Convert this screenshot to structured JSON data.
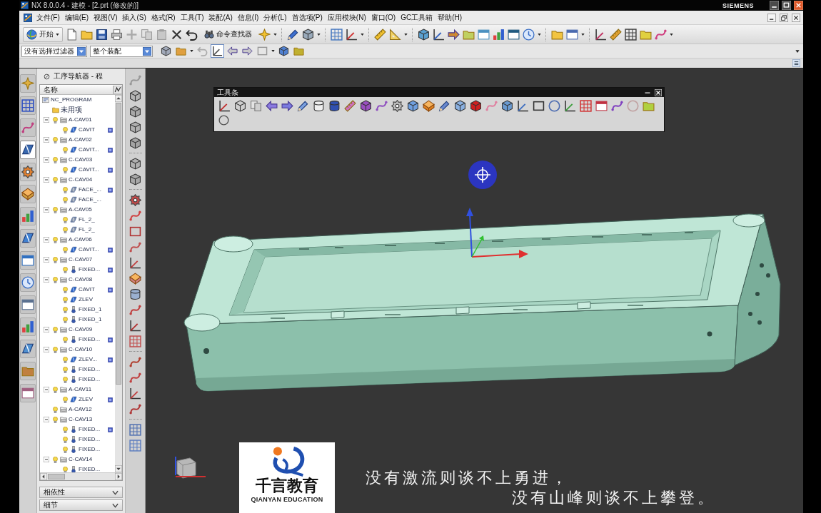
{
  "window": {
    "title": "NX 8.0.0.4 - 建模 - [2.prt (修改的)]",
    "brand": "SIEMENS"
  },
  "menu_bar": {
    "items": [
      "文件(F)",
      "编辑(E)",
      "视图(V)",
      "插入(S)",
      "格式(R)",
      "工具(T)",
      "装配(A)",
      "信息(I)",
      "分析(L)",
      "首选项(P)",
      "应用模块(N)",
      "窗口(O)",
      "GC工具箱",
      "帮助(H)"
    ]
  },
  "standard_toolbar": {
    "start_button": "开始",
    "command_finder": "命令查找器"
  },
  "selection_bar": {
    "type_filter": "没有选择过滤器",
    "scope": "整个装配",
    "tools": [
      {
        "selected": false
      },
      {
        "selected": false
      },
      {
        "selected": false
      },
      {
        "selected": true
      },
      {
        "selected": false
      },
      {
        "selected": false
      },
      {
        "selected": false
      },
      {
        "selected": false
      },
      {
        "selected": false
      }
    ]
  },
  "resource_bar": {
    "tabs": [
      {
        "selected": false
      },
      {
        "selected": false
      },
      {
        "selected": false
      },
      {
        "selected": true
      },
      {
        "selected": false
      },
      {
        "selected": false
      },
      {
        "selected": false
      },
      {
        "selected": false
      },
      {
        "selected": false
      },
      {
        "selected": false
      },
      {
        "selected": false
      },
      {
        "selected": false
      },
      {
        "selected": false
      },
      {
        "selected": false
      },
      {
        "selected": false
      }
    ]
  },
  "navigator": {
    "title": "工序导航器 - 程",
    "column": "名称",
    "tree": [
      {
        "label": "NC_PROGRAM",
        "kind": "root",
        "children": [
          {
            "label": "未用项",
            "kind": "folder"
          },
          {
            "label": "A-CAV01",
            "kind": "program",
            "expanded": true,
            "children": [
              {
                "label": "CAVIT",
                "kind": "rough",
                "flagged": true
              }
            ]
          },
          {
            "label": "A-CAV02",
            "kind": "program",
            "expanded": true,
            "children": [
              {
                "label": "CAVIT...",
                "kind": "rough",
                "flagged": true
              }
            ]
          },
          {
            "label": "C-CAV03",
            "kind": "program",
            "expanded": true,
            "children": [
              {
                "label": "CAVIT...",
                "kind": "rough",
                "flagged": true
              }
            ]
          },
          {
            "label": "C-CAV04",
            "kind": "program",
            "expanded": true,
            "children": [
              {
                "label": "FACE_...",
                "kind": "face",
                "flagged": true
              },
              {
                "label": "FACE_...",
                "kind": "face",
                "flagged": false
              }
            ]
          },
          {
            "label": "A-CAV05",
            "kind": "program",
            "expanded": true,
            "children": [
              {
                "label": "FL_2_",
                "kind": "face",
                "flagged": false
              },
              {
                "label": "FL_2_",
                "kind": "face",
                "flagged": false
              }
            ]
          },
          {
            "label": "A-CAV06",
            "kind": "program",
            "expanded": true,
            "children": [
              {
                "label": "CAVIT...",
                "kind": "rough",
                "flagged": true
              }
            ]
          },
          {
            "label": "C-CAV07",
            "kind": "program",
            "expanded": true,
            "children": [
              {
                "label": "FIXED...",
                "kind": "contour",
                "flagged": true
              }
            ]
          },
          {
            "label": "C-CAV08",
            "kind": "program",
            "expanded": true,
            "children": [
              {
                "label": "CAVIT",
                "kind": "rough",
                "flagged": true
              },
              {
                "label": "ZLEV",
                "kind": "rough",
                "flagged": false
              },
              {
                "label": "FIXED_1",
                "kind": "contour",
                "flagged": false
              },
              {
                "label": "FIXED_1",
                "kind": "contour",
                "flagged": false
              }
            ]
          },
          {
            "label": "C-CAV09",
            "kind": "program",
            "expanded": true,
            "children": [
              {
                "label": "FIXED...",
                "kind": "contour",
                "flagged": true
              }
            ]
          },
          {
            "label": "C-CAV10",
            "kind": "program",
            "expanded": true,
            "children": [
              {
                "label": "ZLEV...",
                "kind": "rough",
                "flagged": true
              },
              {
                "label": "FIXED...",
                "kind": "contour",
                "flagged": false
              },
              {
                "label": "FIXED...",
                "kind": "contour",
                "flagged": false
              }
            ]
          },
          {
            "label": "A-CAV11",
            "kind": "program",
            "expanded": true,
            "children": [
              {
                "label": "ZLEV",
                "kind": "rough",
                "flagged": true
              }
            ]
          },
          {
            "label": "A-CAV12",
            "kind": "program"
          },
          {
            "label": "C-CAV13",
            "kind": "program",
            "expanded": true,
            "children": [
              {
                "label": "FIXED...",
                "kind": "contour",
                "flagged": true
              },
              {
                "label": "FIXED...",
                "kind": "contour",
                "flagged": false
              },
              {
                "label": "FIXED...",
                "kind": "contour",
                "flagged": false
              }
            ]
          },
          {
            "label": "C-CAV14",
            "kind": "program",
            "expanded": true,
            "children": [
              {
                "label": "FIXED...",
                "kind": "contour",
                "flagged": false
              }
            ]
          }
        ]
      }
    ],
    "panels": [
      {
        "label": "相依性",
        "expanded": false
      },
      {
        "label": "细节",
        "expanded": false
      }
    ]
  },
  "graphics_window": {
    "floating_toolbar": {
      "title": "工具条"
    },
    "logo": {
      "name": "千言教育",
      "tagline": "QIANYAN EDUCATION"
    },
    "subtitles": [
      "没有激流则谈不上勇进，",
      "没有山峰则谈不上攀登。"
    ]
  }
}
